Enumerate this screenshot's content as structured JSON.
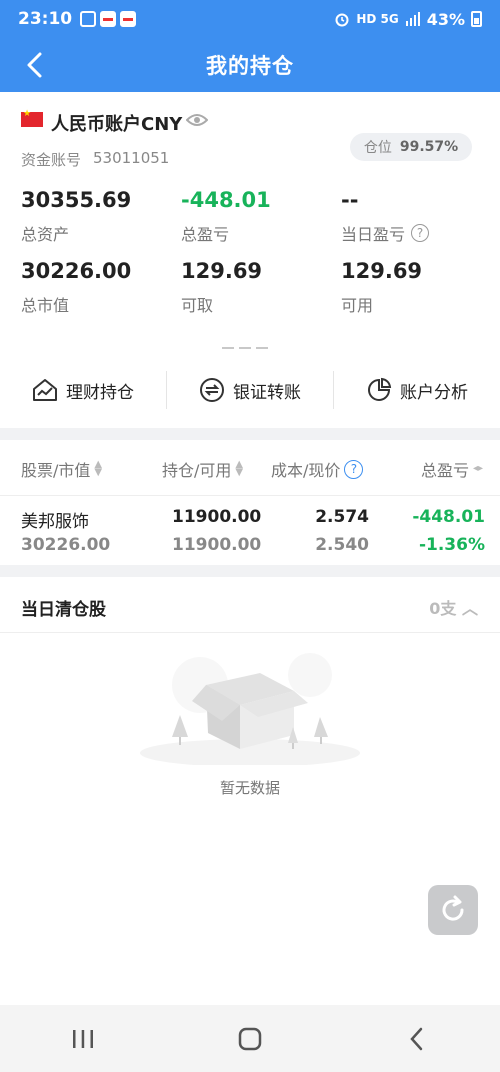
{
  "status_bar": {
    "time": "23:10",
    "network": "HD 5G",
    "battery": "43%"
  },
  "header": {
    "title": "我的持仓"
  },
  "account": {
    "name": "人民币账户CNY",
    "account_no_label": "资金账号",
    "account_no": "53011051",
    "position_label": "仓位",
    "position_value": "99.57%",
    "metrics": [
      {
        "value": "30355.69",
        "label": "总资产"
      },
      {
        "value": "-448.01",
        "label": "总盈亏"
      },
      {
        "value": "--",
        "label": "当日盈亏"
      },
      {
        "value": "30226.00",
        "label": "总市值"
      },
      {
        "value": "129.69",
        "label": "可取"
      },
      {
        "value": "129.69",
        "label": "可用"
      }
    ]
  },
  "quick_actions": [
    {
      "label": "理财持仓",
      "icon": "house-chart-icon"
    },
    {
      "label": "银证转账",
      "icon": "transfer-icon"
    },
    {
      "label": "账户分析",
      "icon": "pie-chart-icon"
    }
  ],
  "holdings": {
    "columns": [
      "股票/市值",
      "持仓/可用",
      "成本/现价",
      "总盈亏"
    ],
    "rows": [
      {
        "name": "美邦服饰",
        "market_value": "30226.00",
        "holding": "11900.00",
        "available": "11900.00",
        "cost": "2.574",
        "price": "2.540",
        "pnl": "-448.01",
        "pnl_pct": "-1.36%"
      }
    ]
  },
  "cleared": {
    "title": "当日清仓股",
    "count": "0支"
  },
  "empty": {
    "text": "暂无数据"
  },
  "colors": {
    "primary": "#3d8ff0",
    "loss": "#18b35a"
  }
}
